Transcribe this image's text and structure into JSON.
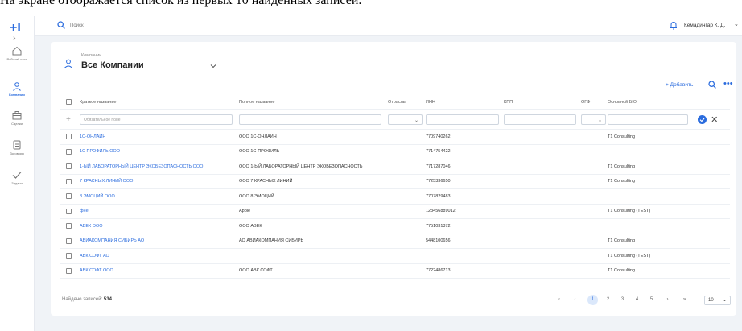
{
  "caption": "На экране отображается список из первых 10 найденных записей.",
  "topbar": {
    "search_placeholder": "Поиск",
    "user_name": "Кемадингар К. Д."
  },
  "sidebar": {
    "items": [
      {
        "label": "Рабочий стол",
        "icon": "home-icon"
      },
      {
        "label": "Компании",
        "icon": "companies-icon"
      },
      {
        "label": "Сделки",
        "icon": "deals-icon"
      },
      {
        "label": "Договоры",
        "icon": "contracts-icon"
      },
      {
        "label": "Задачи",
        "icon": "tasks-icon"
      }
    ]
  },
  "company_selector": {
    "small_label": "Компании",
    "title": "Все Компании"
  },
  "actions": {
    "add_label": "+ Добавить"
  },
  "table": {
    "columns": [
      "Краткое название",
      "Полное название",
      "Отрасль",
      "ИНН",
      "КПП",
      "ОГФ",
      "Основной БЮ"
    ],
    "filter_placeholder": "Обязательное поле",
    "rows": [
      {
        "short": "1С-ОНЛАЙН",
        "full": "ООО 1С-ОНЛАЙН",
        "industry": "",
        "inn": "7709740262",
        "kpp": "",
        "ogf": "",
        "bu": "T1 Consulting"
      },
      {
        "short": "1С ПРОФИЛЬ ООО",
        "full": "ООО 1С-ПРОФИЛЬ",
        "industry": "",
        "inn": "7714754422",
        "kpp": "",
        "ogf": "",
        "bu": ""
      },
      {
        "short": "1-ЫЙ ЛАБОРАТОРНЫЙ ЦЕНТР ЭКОБЕЗОПАСНОСТЬ ООО",
        "full": "ООО 1-ЫЙ ЛАБОРАТОРНЫЙ ЦЕНТР ЭКОБЕЗОПАСНОСТЬ",
        "industry": "",
        "inn": "7717287046",
        "kpp": "",
        "ogf": "",
        "bu": "T1 Consulting"
      },
      {
        "short": "7 КРАСНЫХ ЛИНИЙ ООО",
        "full": "ООО 7 КРАСНЫХ ЛИНИЙ",
        "industry": "",
        "inn": "7725336650",
        "kpp": "",
        "ogf": "",
        "bu": "T1 Consulting"
      },
      {
        "short": "8 ЭМОЦИЙ ООО",
        "full": "ООО 8 ЭМОЦИЙ",
        "industry": "",
        "inn": "7707829483",
        "kpp": "",
        "ogf": "",
        "bu": ""
      },
      {
        "short": "фне",
        "full": "Apple",
        "industry": "",
        "inn": "123456889012",
        "kpp": "",
        "ogf": "",
        "bu": "T1 Consulting (TEST)"
      },
      {
        "short": "АВЕК ООО",
        "full": "ООО АВЕК",
        "industry": "",
        "inn": "7751031372",
        "kpp": "",
        "ogf": "",
        "bu": ""
      },
      {
        "short": "АВИАКОМПАНИЯ СИБИРЬ АО",
        "full": "АО АВИАКОМПАНИЯ СИБИРЬ",
        "industry": "",
        "inn": "5448100656",
        "kpp": "",
        "ogf": "",
        "bu": "T1 Consulting"
      },
      {
        "short": "АВК СОФТ АО",
        "full": "",
        "industry": "",
        "inn": "",
        "kpp": "",
        "ogf": "",
        "bu": "T1 Consulting (TEST)"
      },
      {
        "short": "АВК СОФТ ООО",
        "full": "ООО АВК СОФТ",
        "industry": "",
        "inn": "7722486713",
        "kpp": "",
        "ogf": "",
        "bu": "T1 Consulting"
      }
    ]
  },
  "footer": {
    "found_label": "Найдено записей:",
    "found_count": "534",
    "pages": [
      "1",
      "2",
      "3",
      "4",
      "5"
    ],
    "current_page": "1",
    "page_size": "10"
  },
  "colors": {
    "accent": "#2b6cde",
    "background": "#f0f3f7"
  }
}
